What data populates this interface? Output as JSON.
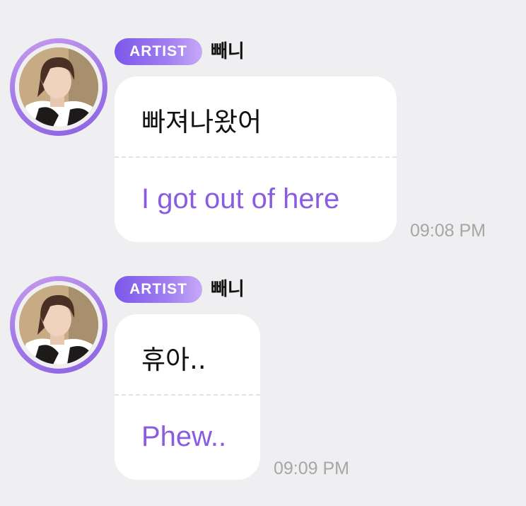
{
  "messages": [
    {
      "badge": "ARTIST",
      "sender": "빼니",
      "original": "빠져나왔어",
      "translation": "I got out of here",
      "time": "09:08 PM"
    },
    {
      "badge": "ARTIST",
      "sender": "빼니",
      "original": "휴아..",
      "translation": "Phew..",
      "time": "09:09 PM"
    }
  ],
  "colors": {
    "background": "#efeef0",
    "bubble": "#ffffff",
    "translation": "#8a5de0",
    "badge_start": "#7b57ea",
    "badge_end": "#c6a9f7",
    "timestamp": "#a6a6a6"
  }
}
